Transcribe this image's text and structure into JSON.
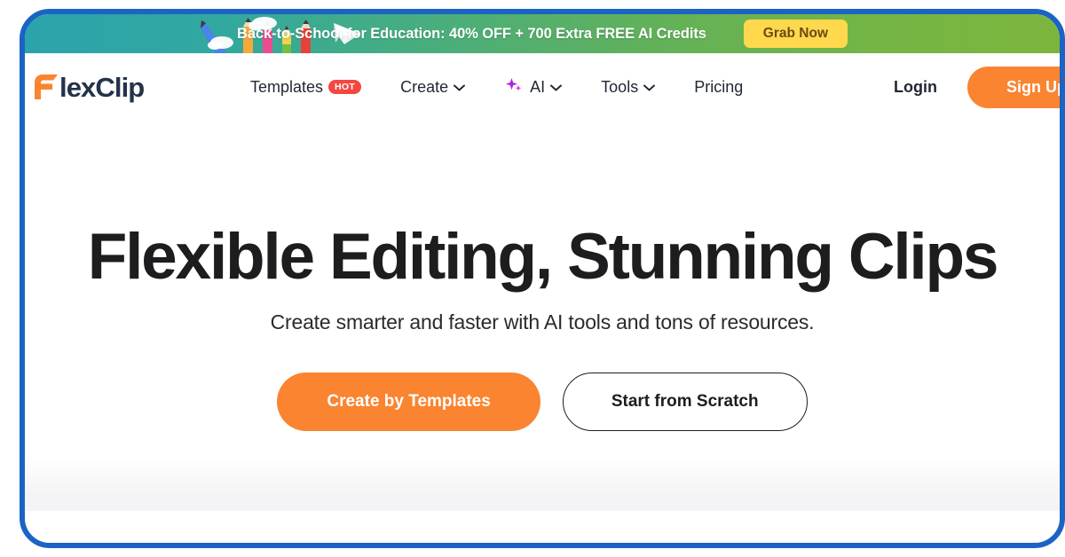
{
  "banner": {
    "text": "Back-to-School for Education: 40% OFF + 700 Extra FREE AI Credits",
    "cta_label": "Grab Now",
    "cta_bg": "#ffd84d",
    "cta_color": "#6b4a12",
    "gradient_from": "#2ba3ac",
    "gradient_to": "#7db53c"
  },
  "header": {
    "logo_text": "lexClip",
    "logo_mark": "flexclip-f-icon",
    "logo_color": "#fa8430",
    "logo_word_color": "#24324a",
    "nav": [
      {
        "label": "Templates",
        "badge": "HOT",
        "badge_color": "#f4473f",
        "has_chevron": false,
        "has_sparkle": false
      },
      {
        "label": "Create",
        "badge": null,
        "has_chevron": true,
        "has_sparkle": false
      },
      {
        "label": "AI",
        "badge": null,
        "has_chevron": true,
        "has_sparkle": true
      },
      {
        "label": "Tools",
        "badge": null,
        "has_chevron": true,
        "has_sparkle": false
      },
      {
        "label": "Pricing",
        "badge": null,
        "has_chevron": false,
        "has_sparkle": false
      }
    ],
    "login_label": "Login",
    "signup_label": "Sign Up",
    "signup_bg": "#fa8430"
  },
  "hero": {
    "title": "Flexible Editing, Stunning Clips",
    "subtitle": "Create smarter and faster with AI tools and tons of resources.",
    "primary_cta": "Create by Templates",
    "secondary_cta": "Start from Scratch",
    "primary_cta_bg": "#fa8430"
  },
  "frame": {
    "border_color": "#1b63c4"
  }
}
